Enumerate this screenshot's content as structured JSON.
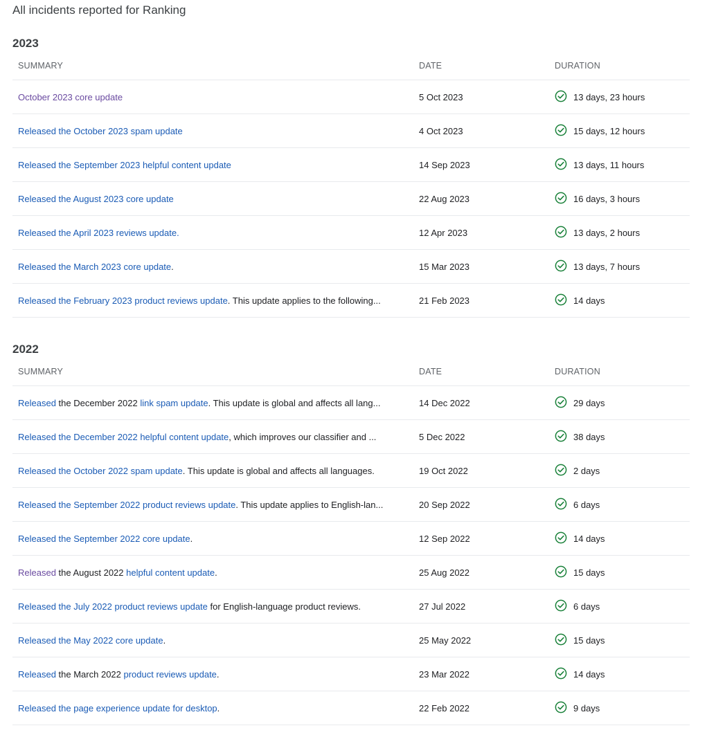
{
  "page": {
    "title": "All incidents reported for Ranking"
  },
  "colors": {
    "link": "#1a5bb5",
    "visited_link": "#6a4aa0",
    "success": "#188038",
    "divider": "#e8eaed"
  },
  "icons": {
    "duration_status": "check-circle-icon"
  },
  "sections": [
    {
      "year": "2023",
      "headers": {
        "summary": "SUMMARY",
        "date": "DATE",
        "duration": "DURATION"
      },
      "rows": [
        {
          "summary": [
            {
              "text": "October 2023 core update",
              "type": "visited"
            }
          ],
          "date": "5 Oct 2023",
          "duration": "13 days, 23 hours"
        },
        {
          "summary": [
            {
              "text": "Released the October 2023 spam update",
              "type": "link"
            }
          ],
          "date": "4 Oct 2023",
          "duration": "15 days, 12 hours"
        },
        {
          "summary": [
            {
              "text": "Released the September 2023 helpful content update",
              "type": "link"
            }
          ],
          "date": "14 Sep 2023",
          "duration": "13 days, 11 hours"
        },
        {
          "summary": [
            {
              "text": "Released the August 2023 core update",
              "type": "link"
            }
          ],
          "date": "22 Aug 2023",
          "duration": "16 days, 3 hours"
        },
        {
          "summary": [
            {
              "text": "Released the April 2023 reviews update.",
              "type": "link"
            }
          ],
          "date": "12 Apr 2023",
          "duration": "13 days, 2 hours"
        },
        {
          "summary": [
            {
              "text": "Released the March 2023 core update",
              "type": "link"
            },
            {
              "text": ".",
              "type": "plain"
            }
          ],
          "date": "15 Mar 2023",
          "duration": "13 days, 7 hours"
        },
        {
          "summary": [
            {
              "text": "Released the February 2023 product reviews update",
              "type": "link"
            },
            {
              "text": ". This update applies to the following...",
              "type": "plain"
            }
          ],
          "date": "21 Feb 2023",
          "duration": "14 days"
        }
      ]
    },
    {
      "year": "2022",
      "headers": {
        "summary": "SUMMARY",
        "date": "DATE",
        "duration": "DURATION"
      },
      "rows": [
        {
          "summary": [
            {
              "text": "Released",
              "type": "link"
            },
            {
              "text": " the December 2022 ",
              "type": "plain"
            },
            {
              "text": "link spam update",
              "type": "link"
            },
            {
              "text": ". This update is global and affects all lang...",
              "type": "plain"
            }
          ],
          "date": "14 Dec 2022",
          "duration": "29 days"
        },
        {
          "summary": [
            {
              "text": "Released the December 2022 helpful content update",
              "type": "link"
            },
            {
              "text": ", which improves our classifier and ...",
              "type": "plain"
            }
          ],
          "date": "5 Dec 2022",
          "duration": "38 days"
        },
        {
          "summary": [
            {
              "text": "Released the October 2022 spam update",
              "type": "link"
            },
            {
              "text": ". This update is global and affects all languages.",
              "type": "plain"
            }
          ],
          "date": "19 Oct 2022",
          "duration": "2 days"
        },
        {
          "summary": [
            {
              "text": "Released the September 2022 product reviews update",
              "type": "link"
            },
            {
              "text": ". This update applies to English-lan...",
              "type": "plain"
            }
          ],
          "date": "20 Sep 2022",
          "duration": "6 days"
        },
        {
          "summary": [
            {
              "text": "Released the September 2022 core update",
              "type": "link"
            },
            {
              "text": ".",
              "type": "plain"
            }
          ],
          "date": "12 Sep 2022",
          "duration": "14 days"
        },
        {
          "summary": [
            {
              "text": "Released",
              "type": "visited"
            },
            {
              "text": " the August 2022 ",
              "type": "plain"
            },
            {
              "text": "helpful content update",
              "type": "link"
            },
            {
              "text": ".",
              "type": "plain"
            }
          ],
          "date": "25 Aug 2022",
          "duration": "15 days"
        },
        {
          "summary": [
            {
              "text": "Released the July 2022 product reviews update",
              "type": "link"
            },
            {
              "text": " for English-language product reviews.",
              "type": "plain"
            }
          ],
          "date": "27 Jul 2022",
          "duration": "6 days"
        },
        {
          "summary": [
            {
              "text": "Released the May 2022 core update",
              "type": "link"
            },
            {
              "text": ".",
              "type": "plain"
            }
          ],
          "date": "25 May 2022",
          "duration": "15 days"
        },
        {
          "summary": [
            {
              "text": "Released",
              "type": "link"
            },
            {
              "text": " the March 2022 ",
              "type": "plain"
            },
            {
              "text": "product reviews update",
              "type": "link"
            },
            {
              "text": ".",
              "type": "plain"
            }
          ],
          "date": "23 Mar 2022",
          "duration": "14 days"
        },
        {
          "summary": [
            {
              "text": "Released the page experience update for desktop",
              "type": "link"
            },
            {
              "text": ".",
              "type": "plain"
            }
          ],
          "date": "22 Feb 2022",
          "duration": "9 days"
        }
      ]
    }
  ]
}
